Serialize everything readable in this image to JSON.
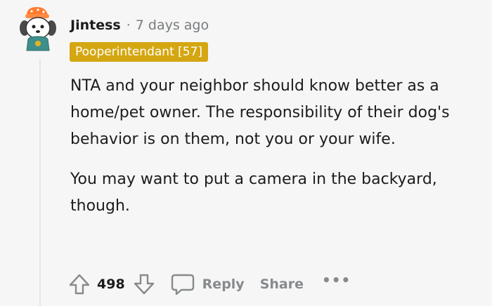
{
  "comment": {
    "author": "Jintess",
    "separator": "·",
    "timestamp": "7 days ago",
    "flair": "Pooperintendant [57]",
    "paragraphs": [
      "NTA and your neighbor should know better as a home/pet owner. The responsibility of their dog's behavior is on them, not you or your wife.",
      "You may want to put a camera in the backyard, though."
    ],
    "score": "498",
    "reply_label": "Reply",
    "share_label": "Share",
    "more_label": "•••"
  },
  "icons": {
    "avatar": "snoo-dog-avatar",
    "upvote": "upvote-arrow-icon",
    "downvote": "downvote-arrow-icon",
    "reply": "speech-bubble-icon",
    "more": "more-options-icon"
  },
  "colors": {
    "background": "#f6f6f6",
    "flair_bg": "#d4a712",
    "muted_text": "#878a8c",
    "thread_line": "#e6e6e6"
  }
}
